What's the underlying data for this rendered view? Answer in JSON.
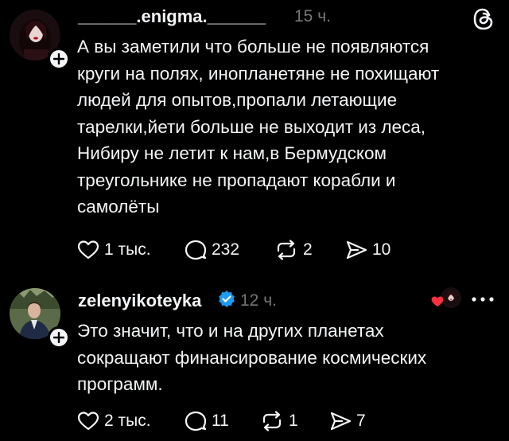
{
  "post": {
    "username": "______.enigma.______",
    "time": "15 ч.",
    "text_lines": [
      "А вы заметили что больше не появляются",
      "круги на полях, инопланетяне не похищают",
      "людей для опытов,пропали летающие",
      "тарелки,йети больше не выходит из леса,",
      "Нибиру не летит к нам,в Бермудском",
      "треугольнике не пропадают корабли и",
      "самолёты"
    ],
    "actions": {
      "likes": "1 тыс.",
      "replies": "232",
      "reposts": "2",
      "shares": "10"
    }
  },
  "reply": {
    "username": "zelenyikoteyka",
    "time": "12 ч.",
    "text_lines": [
      "Это значит, что и на других планетах",
      "сокращают финансирование космических",
      "программ."
    ],
    "actions": {
      "likes": "2 тыс.",
      "replies": "11",
      "reposts": "1",
      "shares": "7"
    }
  },
  "colors": {
    "background": "#000000",
    "text": "#f3f5f7",
    "muted": "#777777",
    "verified": "#1d9bf0",
    "heart": "#ff3040"
  },
  "icons": [
    "threads-logo-icon",
    "plus-icon",
    "verified-icon",
    "more-icon",
    "heart-icon",
    "comment-icon",
    "repost-icon",
    "share-icon"
  ]
}
